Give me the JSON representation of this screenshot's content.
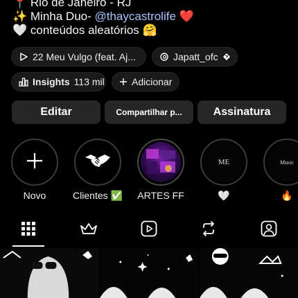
{
  "bio": {
    "location": "📍 Rio de Janeiro - RJ",
    "duo_prefix": "✨ Minha Duo- ",
    "duo_handle": "@thaycastrolife",
    "duo_suffix": " ❤️",
    "content": "🤍 conteúdos aleatórios 🤗"
  },
  "chips": {
    "music": "22 Meu Vulgo (feat. Aj...",
    "threads": "Japatt_ofc",
    "insights_label": "Insights",
    "insights_count": "113 mil",
    "add": "Adicionar"
  },
  "actions": {
    "edit": "Editar",
    "share": "Compartilhar p...",
    "subscription": "Assinatura"
  },
  "highlights": [
    {
      "label": "Novo"
    },
    {
      "label": "Clientes ✅"
    },
    {
      "label": "ARTES FF"
    },
    {
      "label": "🤍"
    },
    {
      "label": "🔥"
    }
  ],
  "highlight_covers": {
    "h3": "ME",
    "h4": "Music"
  },
  "tabs": [
    "grid-icon",
    "crown-icon",
    "reels-icon",
    "reposts-icon",
    "tagged-icon"
  ],
  "colors": {
    "link": "#a8c4ff",
    "button_bg": "#262626",
    "background": "#000000"
  }
}
